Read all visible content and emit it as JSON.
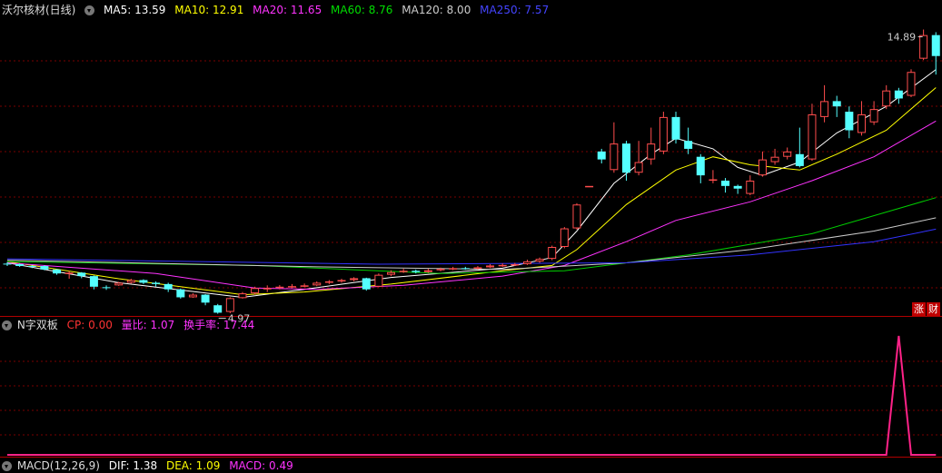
{
  "main_header": {
    "stock_name": "沃尔核材(日线)",
    "ma5": "MA5: 13.59",
    "ma10": "MA10: 12.91",
    "ma20": "MA20: 11.65",
    "ma60": "MA60: 8.76",
    "ma120": "MA120: 8.00",
    "ma250": "MA250: 7.57"
  },
  "badges": {
    "zhang": "涨",
    "cai": "财"
  },
  "indicator_header": {
    "name": "N字双板",
    "cp": "CP: 0.00",
    "liangbi": "量比: 1.07",
    "huanshoulv": "换手率: 17.44"
  },
  "macd_header": {
    "name": "MACD(12,26,9)",
    "dif": "DIF: 1.38",
    "dea": "DEA: 1.09",
    "macd": "MACD: 0.49"
  },
  "colors": {
    "up": "#ff4d4d",
    "down": "#54ffff",
    "ma5": "#ffffff",
    "ma10": "#ffff00",
    "ma20": "#ff33ff",
    "ma60": "#00cc00",
    "ma120": "#cccccc",
    "ma250": "#3333ff",
    "grid": "#7a0000",
    "indicator": "#ff2288"
  },
  "chart_data": [
    {
      "type": "candlestick",
      "title": "沃尔核材(日线)",
      "ylim": [
        4.4,
        15.7
      ],
      "annotations": {
        "high": "14.89",
        "low": "4.97"
      },
      "candles": [
        [
          6.27,
          6.25,
          6.33,
          6.18
        ],
        [
          6.25,
          6.18,
          6.28,
          6.15
        ],
        [
          6.18,
          6.15,
          6.22,
          6.1
        ],
        [
          6.18,
          6.05,
          6.21,
          6.02
        ],
        [
          6.05,
          5.9,
          6.07,
          5.85
        ],
        [
          5.92,
          5.93,
          6.0,
          5.7
        ],
        [
          5.93,
          5.8,
          5.95,
          5.72
        ],
        [
          5.8,
          5.4,
          5.82,
          5.3
        ],
        [
          5.38,
          5.36,
          5.45,
          5.28
        ],
        [
          5.45,
          5.55,
          5.58,
          5.43
        ],
        [
          5.55,
          5.65,
          5.7,
          5.52
        ],
        [
          5.65,
          5.55,
          5.68,
          5.5
        ],
        [
          5.55,
          5.5,
          5.6,
          5.4
        ],
        [
          5.5,
          5.3,
          5.55,
          5.2
        ],
        [
          5.3,
          5.0,
          5.33,
          4.95
        ],
        [
          5.0,
          5.1,
          5.15,
          4.98
        ],
        [
          5.1,
          4.8,
          5.12,
          4.7
        ],
        [
          4.7,
          4.42,
          4.75,
          4.38
        ],
        [
          4.45,
          4.97,
          5.0,
          4.4
        ],
        [
          4.97,
          5.15,
          5.2,
          4.95
        ],
        [
          5.15,
          5.35,
          5.4,
          5.1
        ],
        [
          5.35,
          5.35,
          5.45,
          5.2
        ],
        [
          5.35,
          5.4,
          5.46,
          5.3
        ],
        [
          5.4,
          5.42,
          5.5,
          5.35
        ],
        [
          5.42,
          5.45,
          5.52,
          5.38
        ],
        [
          5.45,
          5.55,
          5.6,
          5.42
        ],
        [
          5.55,
          5.6,
          5.65,
          5.5
        ],
        [
          5.6,
          5.65,
          5.7,
          5.55
        ],
        [
          5.65,
          5.72,
          5.76,
          5.6
        ],
        [
          5.72,
          5.3,
          5.74,
          5.25
        ],
        [
          5.4,
          5.85,
          5.9,
          5.38
        ],
        [
          5.85,
          5.95,
          6.02,
          5.8
        ],
        [
          5.95,
          6.0,
          6.08,
          5.92
        ],
        [
          6.0,
          5.95,
          6.05,
          5.9
        ],
        [
          5.95,
          6.02,
          6.08,
          5.92
        ],
        [
          6.02,
          6.07,
          6.12,
          5.98
        ],
        [
          6.07,
          6.1,
          6.15,
          6.02
        ],
        [
          6.1,
          6.08,
          6.15,
          6.04
        ],
        [
          6.08,
          6.13,
          6.18,
          6.05
        ],
        [
          6.13,
          6.2,
          6.25,
          6.1
        ],
        [
          6.2,
          6.22,
          6.28,
          6.15
        ],
        [
          6.22,
          6.25,
          6.3,
          6.18
        ],
        [
          6.25,
          6.35,
          6.42,
          6.22
        ],
        [
          6.35,
          6.45,
          6.5,
          6.3
        ],
        [
          6.45,
          6.9,
          6.95,
          6.4
        ],
        [
          6.9,
          7.6,
          7.65,
          6.85
        ],
        [
          7.6,
          8.5,
          8.55,
          7.55
        ],
        [
          9.2,
          9.2,
          9.2,
          9.2
        ],
        [
          10.5,
          10.2,
          10.6,
          10.05
        ],
        [
          9.8,
          10.8,
          11.6,
          9.7
        ],
        [
          10.8,
          9.7,
          10.9,
          9.4
        ],
        [
          9.7,
          10.1,
          10.9,
          9.6
        ],
        [
          10.2,
          10.8,
          11.4,
          10.0
        ],
        [
          10.5,
          11.8,
          12.0,
          10.4
        ],
        [
          11.8,
          10.95,
          12.0,
          10.8
        ],
        [
          10.9,
          10.6,
          11.4,
          10.4
        ],
        [
          10.3,
          9.6,
          10.4,
          9.3
        ],
        [
          9.4,
          9.45,
          9.8,
          9.3
        ],
        [
          9.4,
          9.2,
          9.5,
          8.95
        ],
        [
          9.2,
          9.1,
          9.25,
          8.9
        ],
        [
          8.9,
          9.4,
          9.6,
          8.85
        ],
        [
          9.6,
          10.2,
          10.5,
          9.55
        ],
        [
          10.1,
          10.3,
          10.6,
          10.0
        ],
        [
          10.3,
          10.5,
          10.65,
          10.2
        ],
        [
          10.4,
          9.95,
          11.4,
          9.9
        ],
        [
          10.2,
          11.9,
          12.3,
          10.15
        ],
        [
          11.8,
          12.4,
          13.0,
          11.6
        ],
        [
          12.4,
          12.2,
          12.6,
          11.8
        ],
        [
          12.0,
          11.3,
          12.2,
          11.0
        ],
        [
          11.2,
          11.9,
          12.4,
          11.1
        ],
        [
          11.6,
          12.1,
          12.4,
          11.5
        ],
        [
          12.2,
          12.8,
          13.0,
          12.1
        ],
        [
          12.8,
          12.5,
          12.9,
          12.3
        ],
        [
          12.6,
          13.5,
          13.6,
          12.55
        ],
        [
          14.0,
          14.89,
          15.1,
          13.95
        ],
        [
          14.89,
          14.1,
          15.0,
          13.4
        ]
      ],
      "ma_series": [
        {
          "name": "MA5",
          "color": "#ffffff",
          "values": [
            [
              0,
              6.3
            ],
            [
              9,
              5.55
            ],
            [
              19,
              5.0
            ],
            [
              24,
              5.3
            ],
            [
              31,
              5.75
            ],
            [
              40,
              6.1
            ],
            [
              44,
              6.5
            ],
            [
              46,
              7.5
            ],
            [
              49,
              9.3
            ],
            [
              52,
              10.4
            ],
            [
              54,
              11.0
            ],
            [
              57,
              10.6
            ],
            [
              59,
              9.9
            ],
            [
              61,
              9.6
            ],
            [
              64,
              10.1
            ],
            [
              67,
              11.2
            ],
            [
              71,
              12.2
            ],
            [
              75,
              13.59
            ]
          ]
        },
        {
          "name": "MA10",
          "color": "#ffff00",
          "values": [
            [
              0,
              6.35
            ],
            [
              9,
              5.7
            ],
            [
              19,
              5.1
            ],
            [
              24,
              5.2
            ],
            [
              31,
              5.5
            ],
            [
              40,
              6.0
            ],
            [
              44,
              6.2
            ],
            [
              46,
              6.8
            ],
            [
              50,
              8.5
            ],
            [
              54,
              9.8
            ],
            [
              57,
              10.3
            ],
            [
              60,
              10.0
            ],
            [
              64,
              9.8
            ],
            [
              67,
              10.4
            ],
            [
              71,
              11.3
            ],
            [
              75,
              12.91
            ]
          ]
        },
        {
          "name": "MA20",
          "color": "#ff33ff",
          "values": [
            [
              0,
              6.3
            ],
            [
              12,
              5.9
            ],
            [
              20,
              5.35
            ],
            [
              25,
              5.3
            ],
            [
              32,
              5.45
            ],
            [
              40,
              5.8
            ],
            [
              45,
              6.2
            ],
            [
              50,
              7.1
            ],
            [
              54,
              7.9
            ],
            [
              60,
              8.6
            ],
            [
              65,
              9.4
            ],
            [
              70,
              10.3
            ],
            [
              75,
              11.65
            ]
          ]
        },
        {
          "name": "MA60",
          "color": "#00cc00",
          "values": [
            [
              0,
              6.35
            ],
            [
              20,
              6.2
            ],
            [
              35,
              5.9
            ],
            [
              45,
              6.0
            ],
            [
              55,
              6.6
            ],
            [
              65,
              7.4
            ],
            [
              75,
              8.76
            ]
          ]
        },
        {
          "name": "MA120",
          "color": "#cccccc",
          "values": [
            [
              0,
              6.4
            ],
            [
              25,
              6.15
            ],
            [
              40,
              6.05
            ],
            [
              50,
              6.3
            ],
            [
              60,
              6.8
            ],
            [
              70,
              7.5
            ],
            [
              75,
              8.0
            ]
          ]
        },
        {
          "name": "MA250",
          "color": "#3333ff",
          "values": [
            [
              0,
              6.45
            ],
            [
              30,
              6.25
            ],
            [
              50,
              6.3
            ],
            [
              60,
              6.6
            ],
            [
              70,
              7.1
            ],
            [
              75,
              7.57
            ]
          ]
        }
      ]
    },
    {
      "type": "line",
      "title": "N字双板",
      "ylim": [
        0,
        1
      ],
      "series": [
        {
          "name": "N字双板",
          "values": [
            [
              0,
              0
            ],
            [
              71,
              0
            ],
            [
              72,
              1
            ],
            [
              73,
              0
            ],
            [
              75,
              0
            ]
          ]
        }
      ]
    }
  ]
}
